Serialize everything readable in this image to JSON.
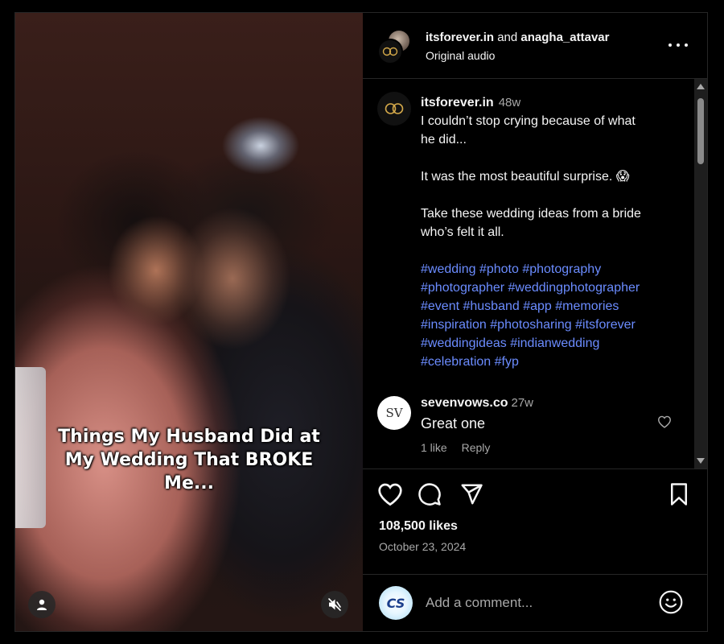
{
  "media": {
    "caption_lines": [
      "Things My Husband Did at",
      "My Wedding That BROKE",
      "Me..."
    ],
    "user_icon": "user-icon",
    "mute_icon": "muted-speaker-icon"
  },
  "header": {
    "user1": "itsforever.in",
    "conjunction": "and",
    "user2": "anagha_attavar",
    "audio": "Original audio",
    "more_icon": "more-options-icon"
  },
  "post": {
    "username": "itsforever.in",
    "time": "48w",
    "lines": [
      "I couldn’t stop crying because of what",
      "he did...",
      "It was the most beautiful surprise. 😱",
      "Take these wedding ideas from a bride",
      "who’s felt it all."
    ],
    "hashtag_lines": [
      "#wedding #photo #photography",
      "#photographer #weddingphotographer",
      "#event #husband #app #memories",
      "#inspiration #photosharing #itsforever",
      "#weddingideas #indianwedding",
      "#celebration #fyp"
    ]
  },
  "comment": {
    "avatar_text": "SV",
    "username": "sevenvows.co",
    "time": "27w",
    "text": "Great one",
    "likes": "1 like",
    "reply": "Reply"
  },
  "actions": {
    "likes": "108,500 likes",
    "date": "October 23, 2024"
  },
  "add_comment": {
    "avatar_text": "CS",
    "placeholder": "Add a comment..."
  },
  "colors": {
    "background": "#000000",
    "text": "#f5f5f5",
    "secondary": "#a8a8a8",
    "hashtag": "#6b8cff",
    "divider": "#262626"
  }
}
